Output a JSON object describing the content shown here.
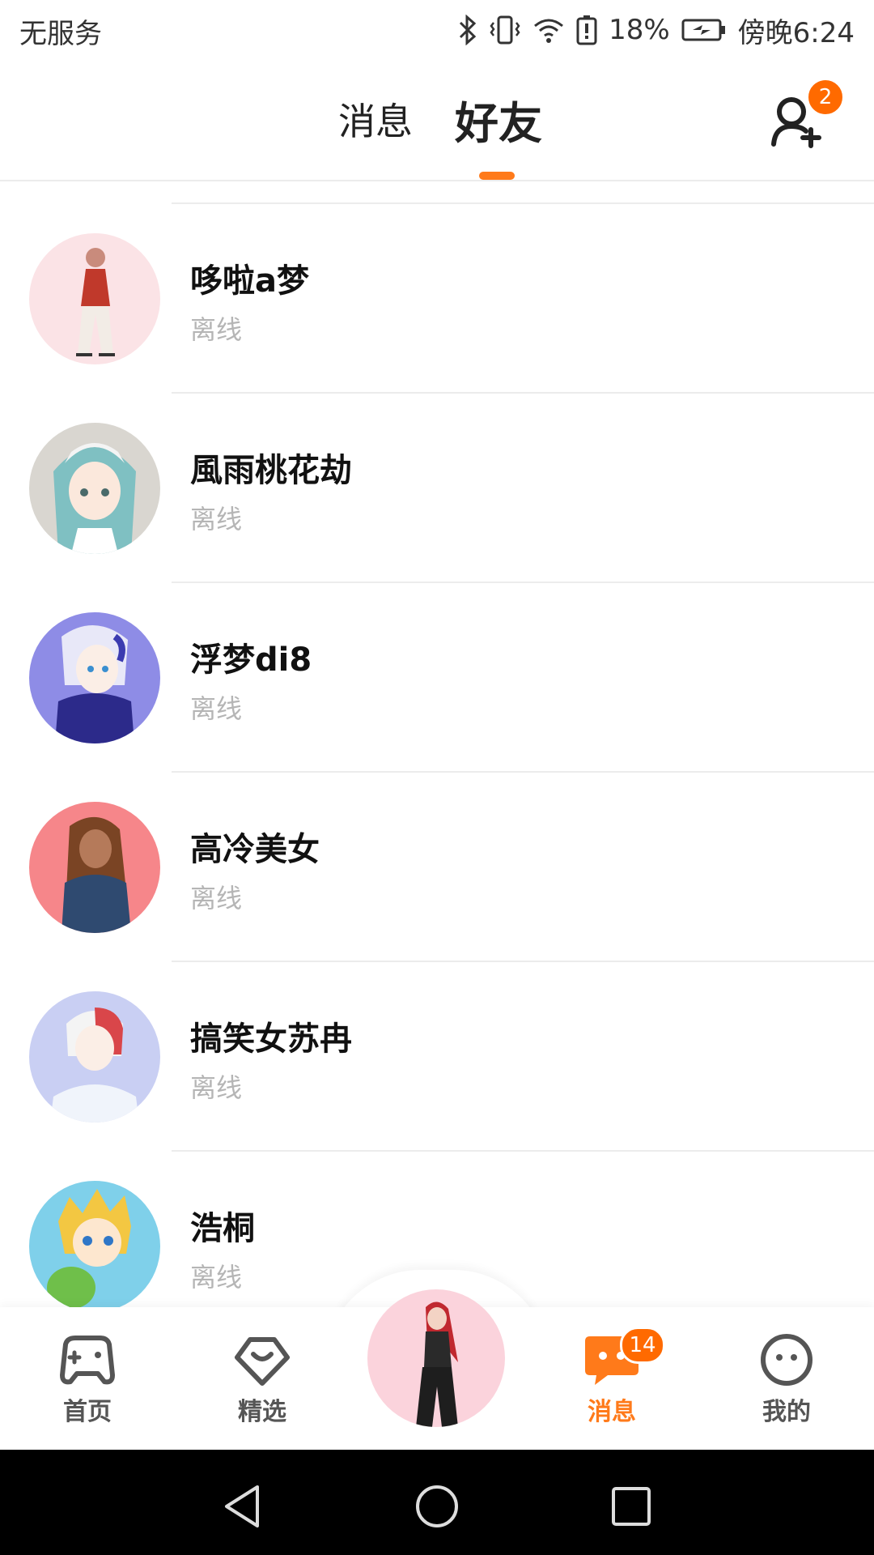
{
  "status_bar": {
    "carrier": "无服务",
    "battery": "18%",
    "time": "傍晚6:24",
    "icons": [
      "bluetooth-icon",
      "vibrate-icon",
      "wifi-icon",
      "battery-alert-icon",
      "battery-charging-icon"
    ]
  },
  "header": {
    "tabs": [
      {
        "label": "消息",
        "active": false
      },
      {
        "label": "好友",
        "active": true
      }
    ],
    "add_friend_badge": "2"
  },
  "friends": [
    {
      "name": "哆啦a梦",
      "status": "离线",
      "avatar_bg": "#fbe3e6"
    },
    {
      "name": "風雨桃花劫",
      "status": "离线",
      "avatar_bg": "#d9d6d0"
    },
    {
      "name": "浮梦di8",
      "status": "离线",
      "avatar_bg": "#5b5ad0"
    },
    {
      "name": "高冷美女",
      "status": "离线",
      "avatar_bg": "#f6868a"
    },
    {
      "name": "搞笑女苏冉",
      "status": "离线",
      "avatar_bg": "#c9cff3"
    },
    {
      "name": "浩桐",
      "status": "离线",
      "avatar_bg": "#7fd0ea"
    }
  ],
  "bottom_nav": {
    "items": [
      {
        "label": "首页",
        "icon": "gamepad-icon",
        "active": false
      },
      {
        "label": "精选",
        "icon": "heart-diamond-icon",
        "active": false
      },
      {
        "label": "消息",
        "icon": "chat-bubble-icon",
        "active": true
      },
      {
        "label": "我的",
        "icon": "face-icon",
        "active": false
      }
    ],
    "message_badge": "14"
  },
  "colors": {
    "accent": "#ff7a1a",
    "badge": "#ff6a00",
    "status_gray": "#b5b5b5"
  }
}
